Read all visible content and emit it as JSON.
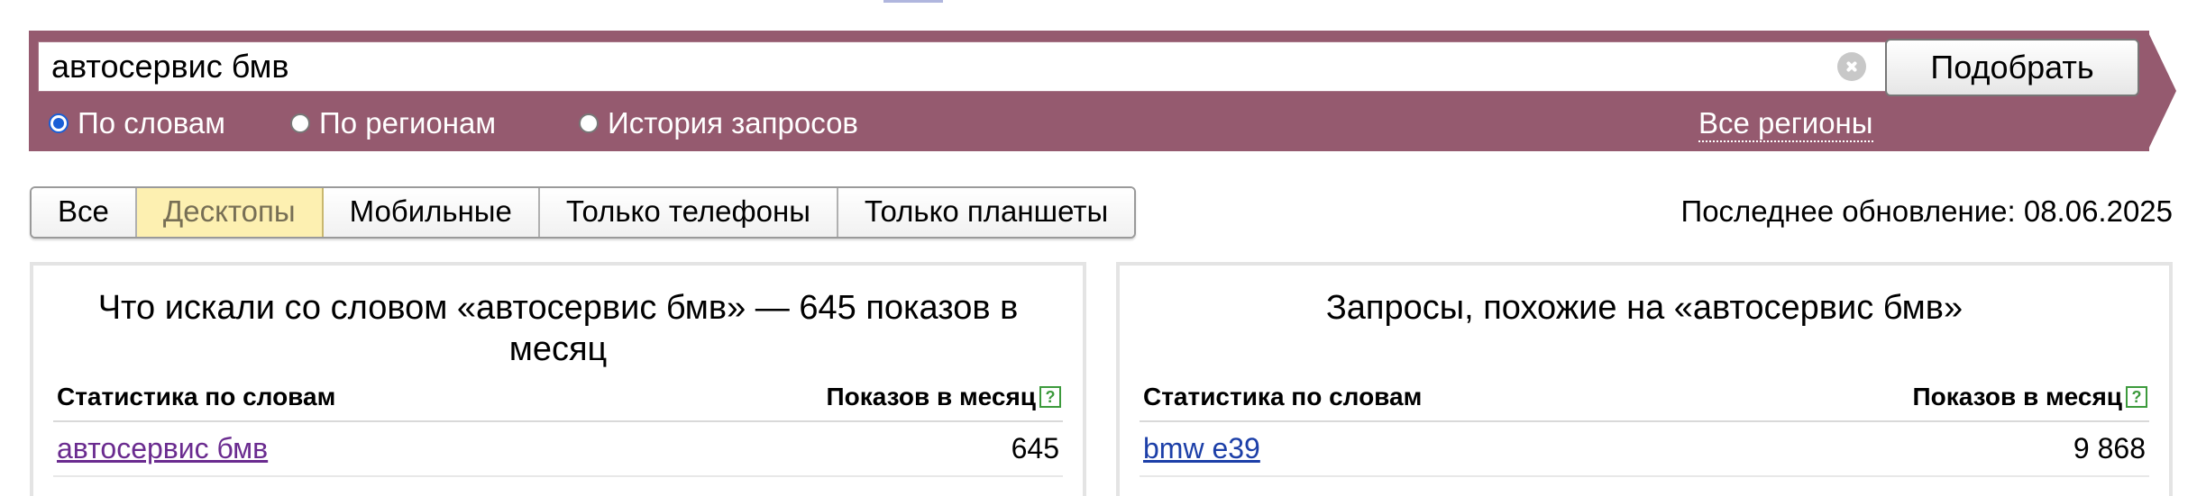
{
  "search": {
    "query": "автосервис бмв",
    "submit_label": "Подобрать",
    "modes": [
      {
        "label": "По словам",
        "checked": true
      },
      {
        "label": "По регионам",
        "checked": false
      },
      {
        "label": "История запросов",
        "checked": false
      }
    ],
    "regions_label": "Все регионы"
  },
  "devices": {
    "tabs": [
      "Все",
      "Десктопы",
      "Мобильные",
      "Только телефоны",
      "Только планшеты"
    ],
    "active": "Десктопы"
  },
  "updated_label": "Последнее обновление: 08.06.2025",
  "panels": {
    "left": {
      "title": "Что искали со словом «автосервис бмв» — 645 показов в месяц",
      "col_words": "Статистика по словам",
      "col_shows": "Показов в месяц",
      "help": "?",
      "rows": [
        {
          "phrase": "автосервис бмв",
          "shows": "645"
        }
      ]
    },
    "right": {
      "title": "Запросы, похожие на «автосервис бмв»",
      "col_words": "Статистика по словам",
      "col_shows": "Показов в месяц",
      "help": "?",
      "rows": [
        {
          "phrase": "bmw e39",
          "shows": "9 868"
        }
      ]
    }
  },
  "colors": {
    "banner": "#955a6f",
    "active_tab": "#fdf0b1",
    "visited_link": "#6a2b8f",
    "link": "#1c3fa8",
    "help_icon": "#3c9a3c"
  }
}
